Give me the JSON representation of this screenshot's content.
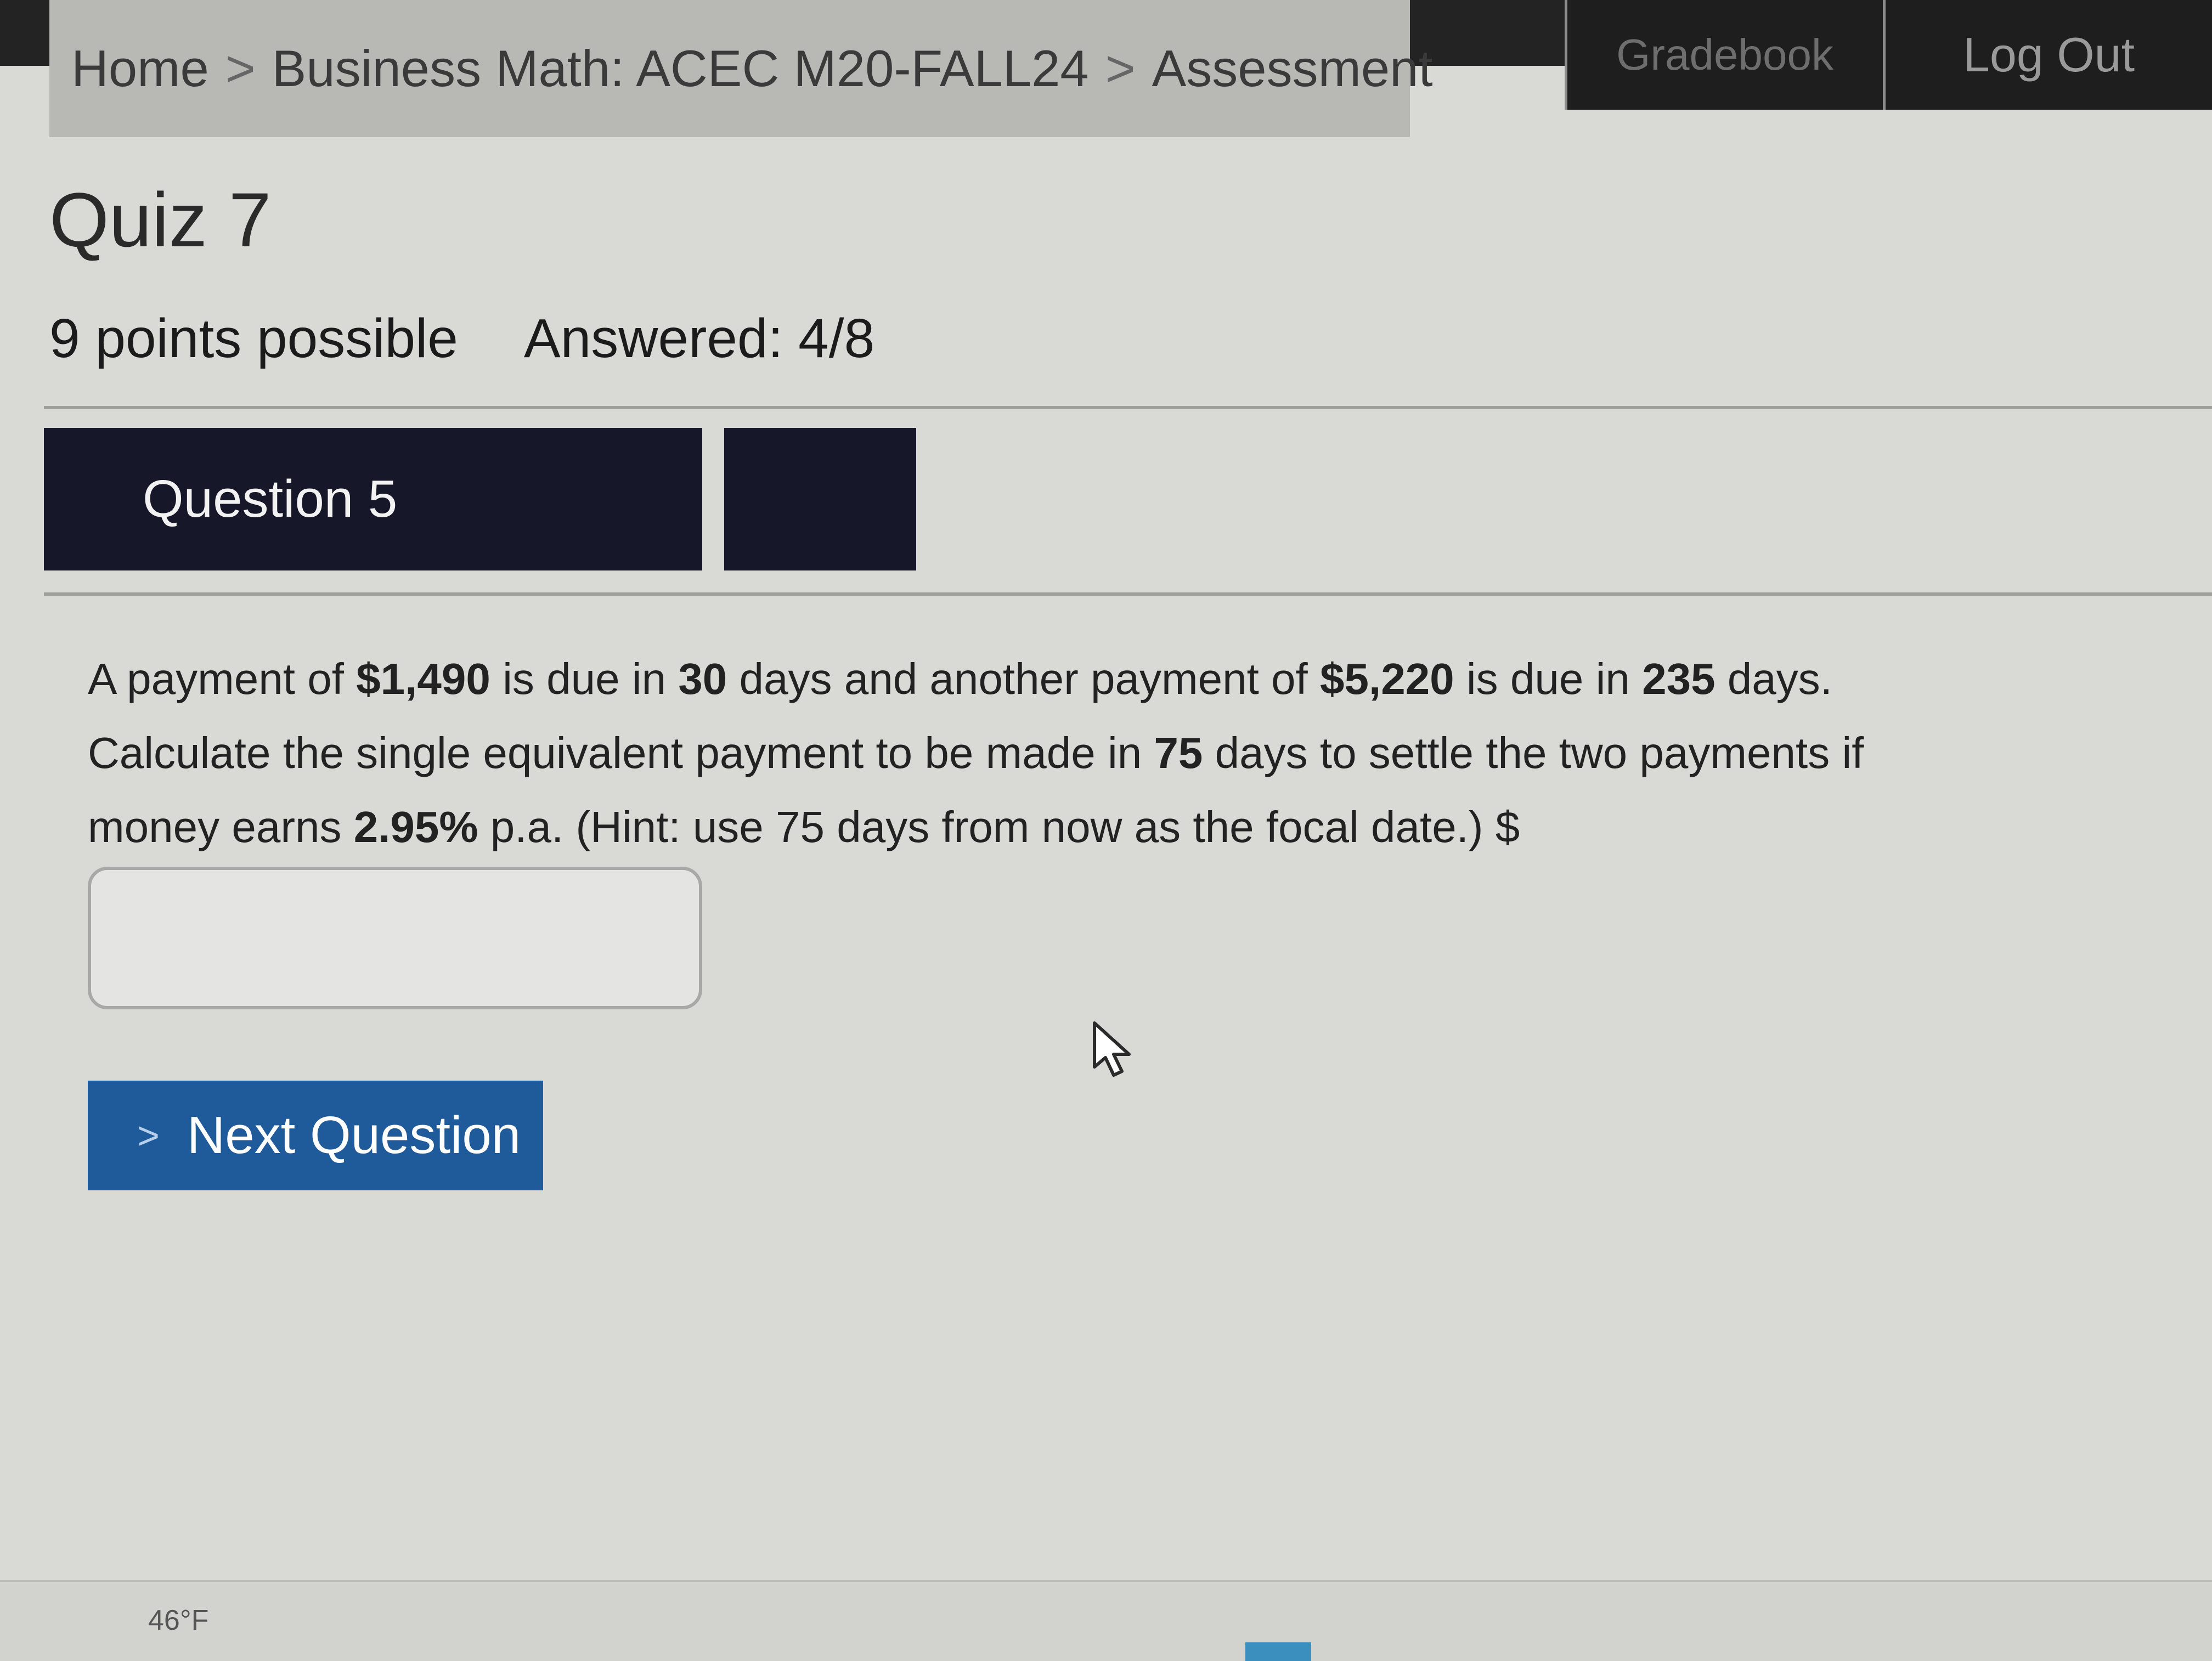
{
  "topnav": {
    "partial_item": "Gradebook",
    "logout_label": "Log Out"
  },
  "breadcrumb": {
    "home": "Home",
    "sep": ">",
    "course": "Business Math: ACEC M20-FALL24",
    "current": "Assessment"
  },
  "quiz": {
    "title": "Quiz 7",
    "points": "9 points possible",
    "answered": "Answered: 4/8"
  },
  "question": {
    "tab_label": "Question 5",
    "parts": {
      "p1": "A payment of ",
      "amount1": "$1,490",
      "p2": " is due in ",
      "days1": "30",
      "p3": " days and another payment of ",
      "amount2": "$5,220",
      "p4": " is due in ",
      "days2": "235",
      "p5": " days. Calculate the single equivalent payment to be made in ",
      "days3": "75",
      "p6": " days to settle the two payments if money earns ",
      "rate": "2.95%",
      "p7": " p.a. (Hint: use 75 days from now as the focal date.) $"
    },
    "answer_value": ""
  },
  "next_button": {
    "chevron": ">",
    "label": "Next Question"
  },
  "taskbar": {
    "weather": "46°F"
  }
}
